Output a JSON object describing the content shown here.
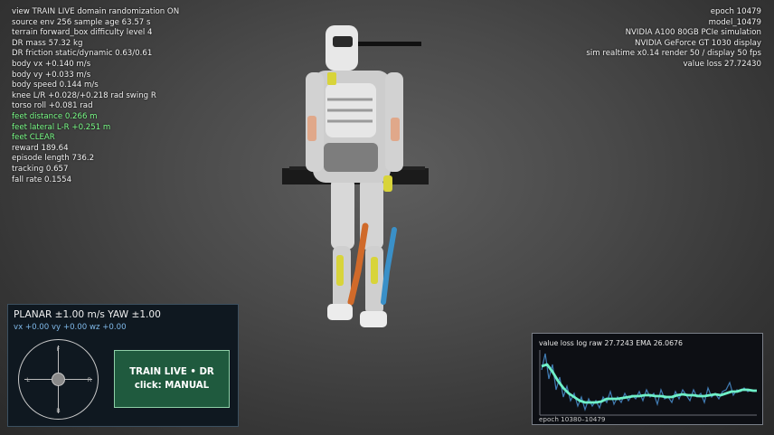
{
  "hud_left": [
    "view TRAIN LIVE  domain randomization ON",
    "source env 256  sample age 63.57 s",
    "terrain forward_box  difficulty level 4",
    "DR mass 57.32 kg",
    "DR friction static/dynamic 0.63/0.61",
    "body vx +0.140 m/s",
    "body vy +0.033 m/s",
    "body speed 0.144 m/s",
    "knee L/R +0.028/+0.218 rad  swing R",
    "torso roll +0.081 rad",
    "feet distance 0.266 m",
    "feet lateral L-R +0.251 m",
    "feet CLEAR",
    "reward 189.64",
    "episode length 736.2",
    "tracking 0.657",
    "fall rate 0.1554"
  ],
  "hud_right": [
    "epoch 10479",
    "model_10479",
    "NVIDIA A100 80GB PCIe simulation",
    "NVIDIA GeForce GT 1030 display",
    "sim realtime x0.14  render 50 / display 50 fps",
    "value loss 27.72430"
  ],
  "control": {
    "title": "PLANAR ±1.00 m/s  YAW ±1.00",
    "velocities": "vx +0.00  vy +0.00  wz +0.00",
    "joystick_labels": {
      "front": "F",
      "back": "B",
      "left": "L",
      "right": "R"
    },
    "train_line1": "TRAIN LIVE • DR",
    "train_line2": "click: MANUAL"
  },
  "loss_plot": {
    "header": "value loss log  raw 27.7243  EMA 26.0676",
    "footer": "epoch 10380–10479"
  },
  "colors": {
    "accent_green": "#7cff8a",
    "velocity_blue": "#7fb8e8",
    "ema_line": "#6ff0c8",
    "raw_line": "#4a8fd0",
    "train_button": "#1f5a3e"
  }
}
